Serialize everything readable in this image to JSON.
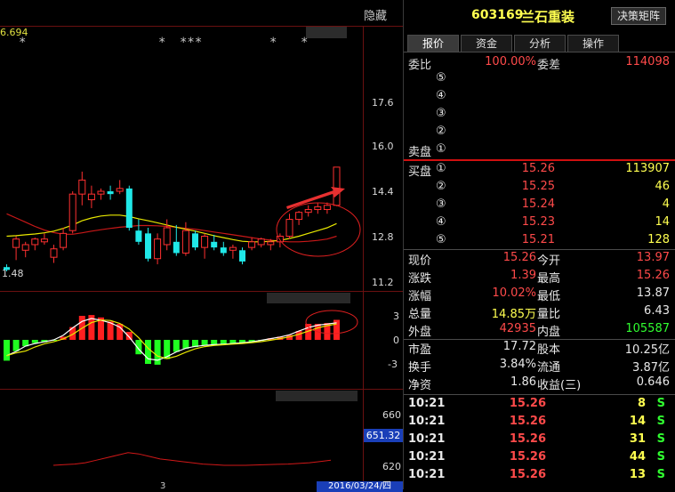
{
  "chart": {
    "hide_label": "隐藏",
    "top_value": "6.694",
    "low_label": "1.48",
    "stars": [
      "*",
      "*",
      "***",
      "*",
      "*"
    ],
    "price_ticks": [
      "17.6",
      "16.0",
      "14.4",
      "12.8",
      "11.2"
    ],
    "macd_ticks": [
      "3",
      "0",
      "-3"
    ],
    "vol_ticks": [
      "660",
      "620"
    ],
    "vol_current": "651.32",
    "date_label": "2016/03/24/四",
    "bottom_tick": "3"
  },
  "chart_data": {
    "type": "candlestick",
    "candles": [
      {
        "o": 11.7,
        "h": 11.8,
        "l": 11.55,
        "c": 11.6
      },
      {
        "o": 12.4,
        "h": 12.8,
        "l": 11.95,
        "c": 12.7
      },
      {
        "o": 12.3,
        "h": 12.6,
        "l": 12.05,
        "c": 12.5
      },
      {
        "o": 12.5,
        "h": 12.75,
        "l": 12.3,
        "c": 12.7
      },
      {
        "o": 12.6,
        "h": 12.9,
        "l": 12.5,
        "c": 12.7
      },
      {
        "o": 12.05,
        "h": 12.5,
        "l": 11.85,
        "c": 12.35
      },
      {
        "o": 12.4,
        "h": 13.1,
        "l": 12.3,
        "c": 12.9
      },
      {
        "o": 13.0,
        "h": 14.4,
        "l": 12.9,
        "c": 14.3
      },
      {
        "o": 14.3,
        "h": 15.1,
        "l": 13.9,
        "c": 14.8
      },
      {
        "o": 14.1,
        "h": 14.6,
        "l": 13.8,
        "c": 14.3
      },
      {
        "o": 14.3,
        "h": 14.5,
        "l": 14.1,
        "c": 14.4
      },
      {
        "o": 14.4,
        "h": 14.6,
        "l": 14.1,
        "c": 14.3
      },
      {
        "o": 14.4,
        "h": 14.8,
        "l": 14.3,
        "c": 14.5
      },
      {
        "o": 14.5,
        "h": 14.6,
        "l": 13.0,
        "c": 13.1
      },
      {
        "o": 13.0,
        "h": 13.4,
        "l": 12.5,
        "c": 12.6
      },
      {
        "o": 12.9,
        "h": 13.1,
        "l": 11.9,
        "c": 12.0
      },
      {
        "o": 12.0,
        "h": 12.9,
        "l": 11.8,
        "c": 12.7
      },
      {
        "o": 12.5,
        "h": 13.4,
        "l": 12.3,
        "c": 13.1
      },
      {
        "o": 12.6,
        "h": 13.2,
        "l": 12.1,
        "c": 12.2
      },
      {
        "o": 12.2,
        "h": 13.3,
        "l": 12.1,
        "c": 13.0
      },
      {
        "o": 12.9,
        "h": 13.0,
        "l": 12.3,
        "c": 12.4
      },
      {
        "o": 12.4,
        "h": 12.9,
        "l": 12.0,
        "c": 12.8
      },
      {
        "o": 12.6,
        "h": 12.85,
        "l": 12.3,
        "c": 12.4
      },
      {
        "o": 12.4,
        "h": 12.6,
        "l": 12.1,
        "c": 12.2
      },
      {
        "o": 12.3,
        "h": 12.5,
        "l": 12.0,
        "c": 12.4
      },
      {
        "o": 12.3,
        "h": 12.4,
        "l": 11.8,
        "c": 11.9
      },
      {
        "o": 12.4,
        "h": 12.75,
        "l": 12.3,
        "c": 12.6
      },
      {
        "o": 12.5,
        "h": 12.75,
        "l": 12.4,
        "c": 12.7
      },
      {
        "o": 12.5,
        "h": 12.7,
        "l": 12.3,
        "c": 12.6
      },
      {
        "o": 12.6,
        "h": 12.9,
        "l": 12.4,
        "c": 12.8
      },
      {
        "o": 12.8,
        "h": 13.6,
        "l": 12.7,
        "c": 13.4
      },
      {
        "o": 13.4,
        "h": 13.7,
        "l": 13.2,
        "c": 13.65
      },
      {
        "o": 13.65,
        "h": 13.9,
        "l": 13.5,
        "c": 13.75
      },
      {
        "o": 13.75,
        "h": 14.0,
        "l": 13.6,
        "c": 13.85
      },
      {
        "o": 13.75,
        "h": 14.0,
        "l": 13.6,
        "c": 13.9
      },
      {
        "o": 13.9,
        "h": 15.26,
        "l": 13.87,
        "c": 15.26
      }
    ],
    "ma_yellow": [
      12.8,
      12.82,
      12.85,
      12.88,
      12.92,
      12.98,
      13.08,
      13.2,
      13.35,
      13.45,
      13.52,
      13.55,
      13.55,
      13.5,
      13.42,
      13.35,
      13.28,
      13.2,
      13.12,
      13.05,
      12.98,
      12.9,
      12.82,
      12.75,
      12.68,
      12.62,
      12.6,
      12.6,
      12.62,
      12.65,
      12.72,
      12.8,
      12.9,
      13.0,
      13.1,
      13.25
    ],
    "ma_red": [
      13.6,
      13.45,
      13.3,
      13.15,
      13.02,
      12.93,
      12.87,
      12.87,
      12.92,
      12.98,
      13.03,
      13.08,
      13.12,
      13.15,
      13.18,
      13.18,
      13.17,
      13.15,
      13.12,
      13.08,
      13.05,
      13.0,
      12.95,
      12.9,
      12.85,
      12.8,
      12.75,
      12.7,
      12.66,
      12.62,
      12.6,
      12.6,
      12.62,
      12.65,
      12.7,
      12.8
    ],
    "macd": [
      -2.6,
      -1.4,
      -0.8,
      -0.4,
      -0.3,
      -0.1,
      0.4,
      1.6,
      3.0,
      3.1,
      2.8,
      2.3,
      2.0,
      1.0,
      -1.8,
      -3.0,
      -3.1,
      -2.4,
      -1.5,
      -1.1,
      -0.9,
      -0.7,
      -0.7,
      -0.6,
      -0.5,
      -0.4,
      -0.3,
      -0.1,
      0.2,
      0.4,
      0.6,
      1.1,
      2.0,
      2.0,
      2.1,
      2.5
    ],
    "vol_line": [
      620,
      620.5,
      621,
      622,
      624,
      626,
      628,
      630,
      629,
      627,
      625,
      624,
      623,
      622,
      621,
      620.5,
      620,
      620,
      620,
      620.3,
      620.5,
      620.8,
      621,
      621.5,
      622,
      623,
      624
    ]
  },
  "panel": {
    "code": "603169",
    "name": "兰石重装",
    "button": "决策矩阵",
    "tabs": [
      "报价",
      "资金",
      "分析",
      "操作"
    ],
    "weibi_label": "委比",
    "weibi_value": "100.00%",
    "weicha_label": "委差",
    "weicha_value": "114098",
    "sell_label": "卖盘",
    "sell_levels": [
      "⑤",
      "④",
      "③",
      "②",
      "①"
    ],
    "buy_label": "买盘",
    "buy_rows": [
      {
        "idx": "①",
        "price": "15.26",
        "vol": "113907"
      },
      {
        "idx": "②",
        "price": "15.25",
        "vol": "46"
      },
      {
        "idx": "③",
        "price": "15.24",
        "vol": "4"
      },
      {
        "idx": "④",
        "price": "15.23",
        "vol": "14"
      },
      {
        "idx": "⑤",
        "price": "15.21",
        "vol": "128"
      }
    ],
    "stats": [
      {
        "l1": "现价",
        "v1": "15.26",
        "c1": "red",
        "l2": "今开",
        "v2": "13.97",
        "c2": "red"
      },
      {
        "l1": "涨跌",
        "v1": "1.39",
        "c1": "red",
        "l2": "最高",
        "v2": "15.26",
        "c2": "red"
      },
      {
        "l1": "涨幅",
        "v1": "10.02%",
        "c1": "red",
        "l2": "最低",
        "v2": "13.87",
        "c2": "white"
      },
      {
        "l1": "总量",
        "v1": "14.85万",
        "c1": "yellow",
        "l2": "量比",
        "v2": "6.43",
        "c2": "white"
      },
      {
        "l1": "外盘",
        "v1": "42935",
        "c1": "red",
        "l2": "内盘",
        "v2": "105587",
        "c2": "green"
      }
    ],
    "stats2": [
      {
        "l1": "市盈",
        "v1": "17.72",
        "l2": "股本",
        "v2": "10.25亿"
      },
      {
        "l1": "换手",
        "v1": "3.84%",
        "l2": "流通",
        "v2": "3.87亿"
      },
      {
        "l1": "净资",
        "v1": "1.86",
        "l2": "收益(三)",
        "v2": "0.646"
      }
    ],
    "ticks": [
      {
        "time": "10:21",
        "price": "15.26",
        "vol": "8",
        "side": "S"
      },
      {
        "time": "10:21",
        "price": "15.26",
        "vol": "14",
        "side": "S"
      },
      {
        "time": "10:21",
        "price": "15.26",
        "vol": "31",
        "side": "S"
      },
      {
        "time": "10:21",
        "price": "15.26",
        "vol": "44",
        "side": "S"
      },
      {
        "time": "10:21",
        "price": "15.26",
        "vol": "13",
        "side": "S"
      }
    ]
  }
}
